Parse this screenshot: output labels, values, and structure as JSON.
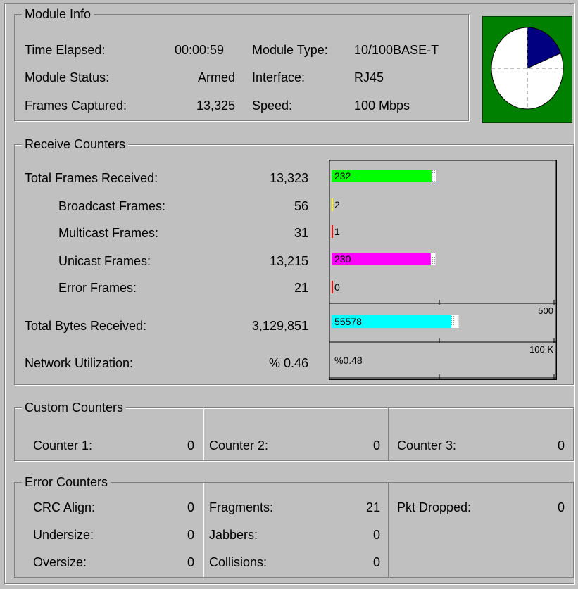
{
  "module_info": {
    "title": "Module Info",
    "time_elapsed_label": "Time Elapsed:",
    "time_elapsed_value": "00:00:59",
    "module_status_label": "Module Status:",
    "module_status_value": "Armed",
    "frames_captured_label": "Frames Captured:",
    "frames_captured_value": "13,325",
    "module_type_label": "Module Type:",
    "module_type_value": "10/100BASE-T",
    "interface_label": "Interface:",
    "interface_value": "RJ45",
    "speed_label": "Speed:",
    "speed_value": "100 Mbps",
    "activity_fraction": 0.19,
    "activity_colors": {
      "background": "#008000",
      "face": "#ffffff",
      "wedge": "#000080"
    }
  },
  "receive_counters": {
    "title": "Receive Counters",
    "rows": [
      {
        "label": "Total Frames Received:",
        "value": "13,323",
        "indent": false
      },
      {
        "label": "Broadcast Frames:",
        "value": "56",
        "indent": true
      },
      {
        "label": "Multicast Frames:",
        "value": "31",
        "indent": true
      },
      {
        "label": "Unicast Frames:",
        "value": "13,215",
        "indent": true
      },
      {
        "label": "Error Frames:",
        "value": "21",
        "indent": true
      }
    ],
    "total_bytes_label": "Total Bytes Received:",
    "total_bytes_value": "3,129,851",
    "utilization_label": "Network Utilization:",
    "utilization_value": "% 0.46"
  },
  "chart_data": {
    "type": "bar",
    "groups": [
      {
        "scale_max": 500,
        "scale_label": "500",
        "bars": [
          {
            "label": "232",
            "value": 232,
            "peak": 243,
            "color": "#00ff00"
          },
          {
            "label": "2",
            "value": 2,
            "peak": 2,
            "color": "#ffff00"
          },
          {
            "label": "1",
            "value": 1,
            "peak": 1,
            "color": "#ff0000"
          },
          {
            "label": "230",
            "value": 230,
            "peak": 241,
            "color": "#ff00ff"
          },
          {
            "label": "0",
            "value": 0,
            "peak": 0,
            "color": "#ff0000"
          }
        ]
      },
      {
        "scale_max": 100000,
        "scale_label": "100 K",
        "bars": [
          {
            "label": "55578",
            "value": 55578,
            "peak": 59000,
            "color": "#00ffff"
          }
        ]
      },
      {
        "scale_max": 100,
        "scale_label": "",
        "bars": [
          {
            "label": "%0.48",
            "value": 0.48,
            "peak": 0.48,
            "color": "#c0c0c0"
          }
        ]
      }
    ]
  },
  "custom_counters": {
    "title": "Custom Counters",
    "items": [
      {
        "label": "Counter 1:",
        "value": "0"
      },
      {
        "label": "Counter 2:",
        "value": "0"
      },
      {
        "label": "Counter 3:",
        "value": "0"
      }
    ]
  },
  "error_counters": {
    "title": "Error Counters",
    "crc_align_label": "CRC Align:",
    "crc_align_value": "0",
    "undersize_label": "Undersize:",
    "undersize_value": "0",
    "oversize_label": "Oversize:",
    "oversize_value": "0",
    "fragments_label": "Fragments:",
    "fragments_value": "21",
    "jabbers_label": "Jabbers:",
    "jabbers_value": "0",
    "collisions_label": "Collisions:",
    "collisions_value": "0",
    "pkt_dropped_label": "Pkt Dropped:",
    "pkt_dropped_value": "0"
  }
}
